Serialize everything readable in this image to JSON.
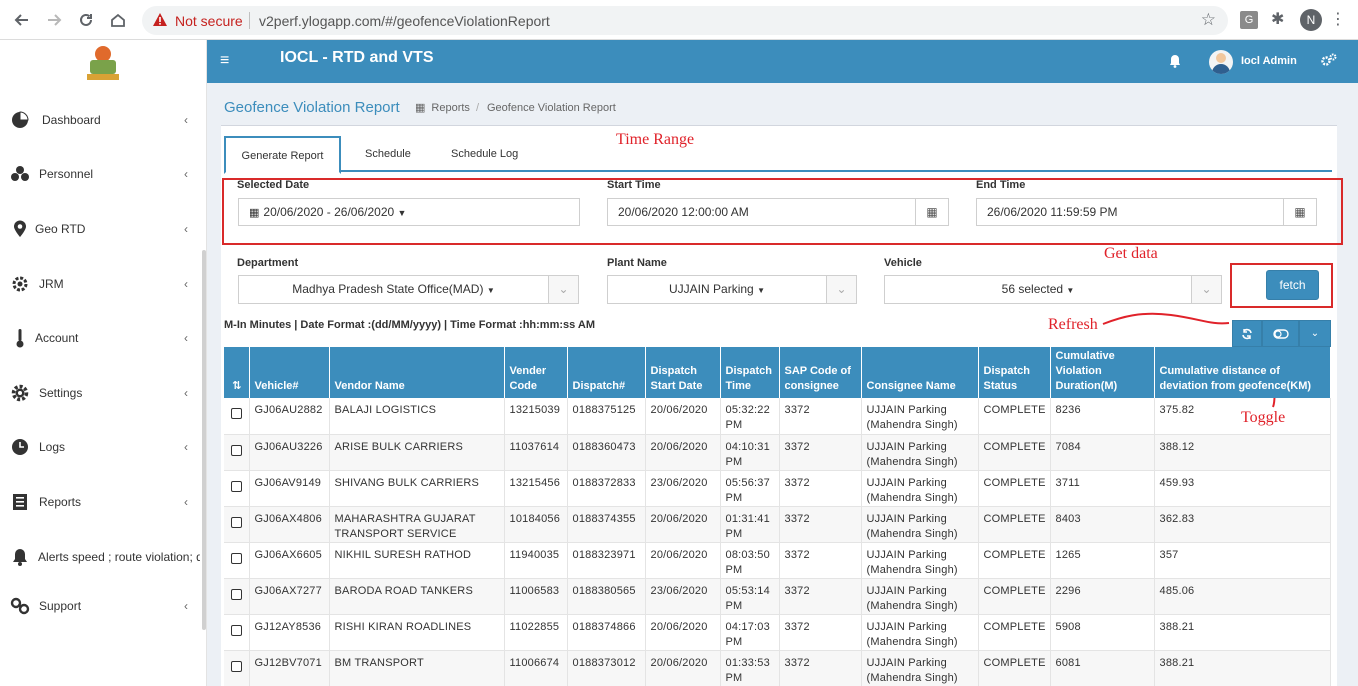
{
  "browser": {
    "not_secure": "Not secure",
    "url": "v2perf.ylogapp.com/#/geofenceViolationReport",
    "ext_g": "G",
    "profile": "N"
  },
  "app": {
    "title": "IOCL - RTD and VTS",
    "user": "Iocl Admin"
  },
  "sidebar": {
    "items": [
      {
        "label": "Dashboard",
        "icon": "pie-chart-icon"
      },
      {
        "label": "Personnel",
        "icon": "users-icon"
      },
      {
        "label": "Geo RTD",
        "icon": "map-marker-icon"
      },
      {
        "label": "JRM",
        "icon": "cog-icon"
      },
      {
        "label": "Account",
        "icon": "thermometer-icon"
      },
      {
        "label": "Settings",
        "icon": "gear-icon"
      },
      {
        "label": "Logs",
        "icon": "clock-icon"
      },
      {
        "label": "Reports",
        "icon": "report-icon"
      },
      {
        "label": "Alerts speed ; route violation; dis",
        "icon": "bell-icon"
      },
      {
        "label": "Support",
        "icon": "link-icon"
      }
    ]
  },
  "page": {
    "title": "Geofence Violation Report",
    "breadcrumb_reports": "Reports",
    "breadcrumb_current": "Geofence Violation Report"
  },
  "tabs": {
    "generate": "Generate Report",
    "schedule": "Schedule",
    "log": "Schedule Log"
  },
  "annotations": {
    "time_range": "Time Range",
    "get_data": "Get data",
    "refresh": "Refresh",
    "toggle": "Toggle"
  },
  "filters": {
    "selected_date_label": "Selected Date",
    "selected_date_value": "20/06/2020 - 26/06/2020",
    "start_time_label": "Start Time",
    "start_time_value": "20/06/2020 12:00:00 AM",
    "end_time_label": "End Time",
    "end_time_value": "26/06/2020 11:59:59 PM",
    "department_label": "Department",
    "department_value": "Madhya Pradesh State Office(MAD)",
    "plant_label": "Plant Name",
    "plant_value": "UJJAIN Parking",
    "vehicle_label": "Vehicle",
    "vehicle_value": "56 selected",
    "fetch_label": "fetch"
  },
  "note": "M-In Minutes | Date Format :(dd/MM/yyyy) | Time Format :hh:mm:ss AM",
  "table": {
    "headers": [
      "Vehicle#",
      "Vendor Name",
      "Vender Code",
      "Dispatch#",
      "Dispatch Start Date",
      "Dispatch Time",
      "SAP Code of consignee",
      "Consignee Name",
      "Dispatch Status",
      "Cumulative Violation Duration(M)",
      "Cumulative distance of deviation from geofence(KM)"
    ],
    "rows": [
      [
        "GJ06AU2882",
        "BALAJI LOGISTICS",
        "13215039",
        "0188375125",
        "20/06/2020",
        "05:32:22 PM",
        "3372",
        "UJJAIN Parking (Mahendra Singh)",
        "COMPLETE",
        "8236",
        "375.82"
      ],
      [
        "GJ06AU3226",
        "ARISE BULK CARRIERS",
        "11037614",
        "0188360473",
        "20/06/2020",
        "04:10:31 PM",
        "3372",
        "UJJAIN Parking (Mahendra Singh)",
        "COMPLETE",
        "7084",
        "388.12"
      ],
      [
        "GJ06AV9149",
        "SHIVANG BULK CARRIERS",
        "13215456",
        "0188372833",
        "23/06/2020",
        "05:56:37 PM",
        "3372",
        "UJJAIN Parking (Mahendra Singh)",
        "COMPLETE",
        "3711",
        "459.93"
      ],
      [
        "GJ06AX4806",
        "MAHARASHTRA GUJARAT TRANSPORT SERVICE",
        "10184056",
        "0188374355",
        "20/06/2020",
        "01:31:41 PM",
        "3372",
        "UJJAIN Parking (Mahendra Singh)",
        "COMPLETE",
        "8403",
        "362.83"
      ],
      [
        "GJ06AX6605",
        "NIKHIL SURESH RATHOD",
        "11940035",
        "0188323971",
        "20/06/2020",
        "08:03:50 PM",
        "3372",
        "UJJAIN Parking (Mahendra Singh)",
        "COMPLETE",
        "1265",
        "357"
      ],
      [
        "GJ06AX7277",
        "BARODA ROAD TANKERS",
        "11006583",
        "0188380565",
        "23/06/2020",
        "05:53:14 PM",
        "3372",
        "UJJAIN Parking (Mahendra Singh)",
        "COMPLETE",
        "2296",
        "485.06"
      ],
      [
        "GJ12AY8536",
        "RISHI KIRAN ROADLINES",
        "11022855",
        "0188374866",
        "20/06/2020",
        "04:17:03 PM",
        "3372",
        "UJJAIN Parking (Mahendra Singh)",
        "COMPLETE",
        "5908",
        "388.21"
      ],
      [
        "GJ12BV7071",
        "BM TRANSPORT",
        "11006674",
        "0188373012",
        "20/06/2020",
        "01:33:53 PM",
        "3372",
        "UJJAIN Parking (Mahendra Singh)",
        "COMPLETE",
        "6081",
        "388.21"
      ]
    ]
  },
  "colors": {
    "primary": "#3c8dbc",
    "annotation": "#e0222a"
  }
}
